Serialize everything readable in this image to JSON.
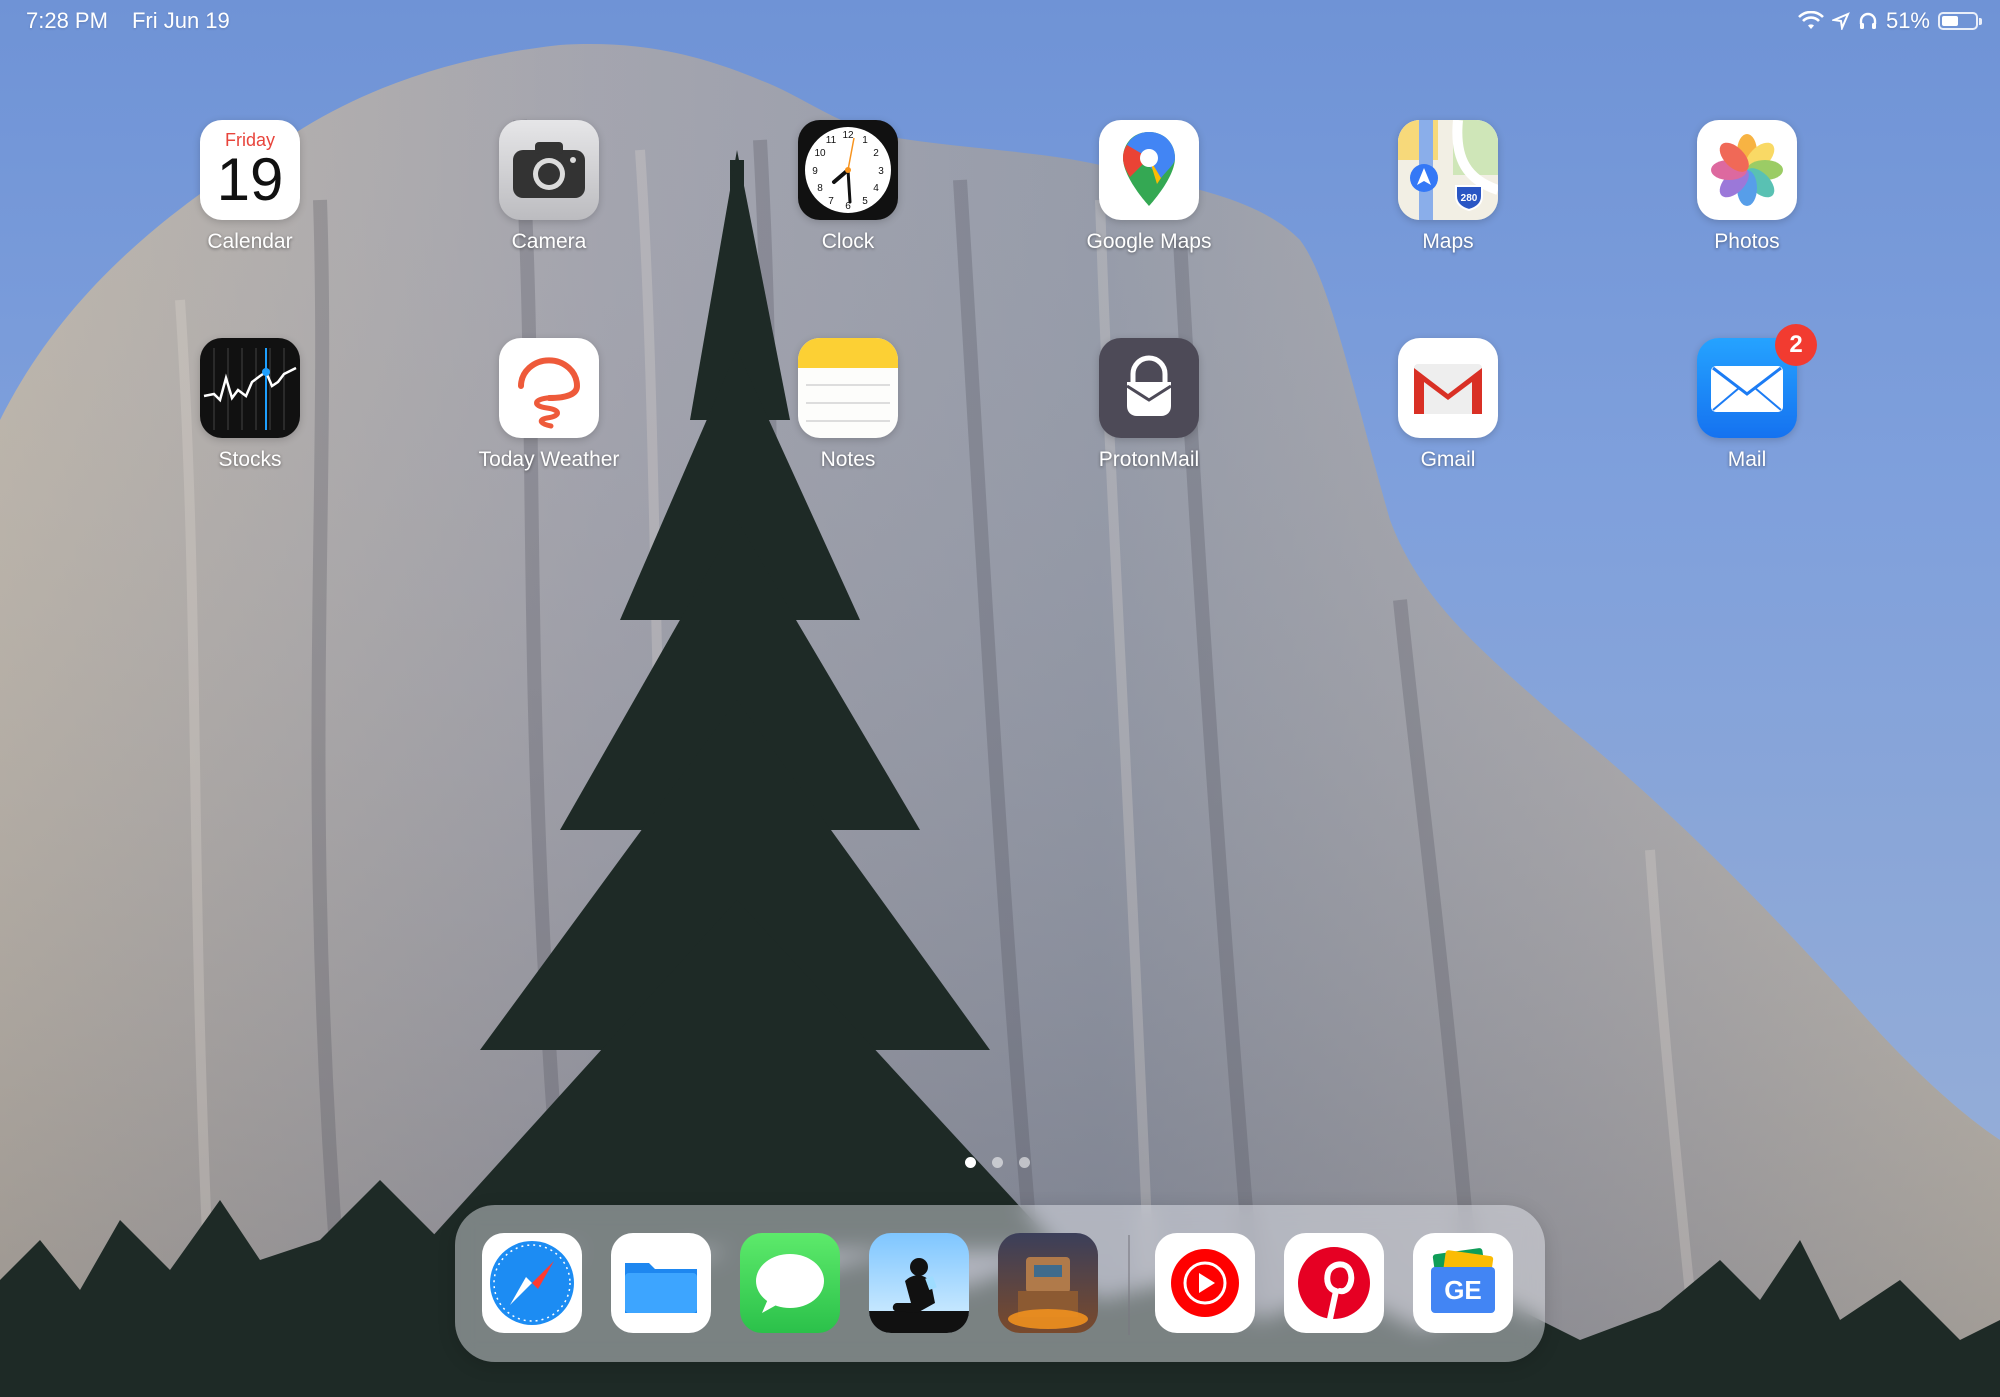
{
  "status_bar": {
    "time": "7:28 PM",
    "date": "Fri Jun 19",
    "battery_percent": "51%",
    "battery_level": 0.51,
    "icons": [
      "wifi-icon",
      "location-icon",
      "headphones-icon",
      "battery-icon"
    ]
  },
  "apps": [
    {
      "name": "Calendar",
      "icon": "calendar-icon",
      "day": "Friday",
      "date": "19"
    },
    {
      "name": "Camera",
      "icon": "camera-icon"
    },
    {
      "name": "Clock",
      "icon": "clock-icon",
      "numerals": [
        "12",
        "1",
        "2",
        "3",
        "4",
        "5",
        "6",
        "7",
        "8",
        "9",
        "10",
        "11"
      ]
    },
    {
      "name": "Google Maps",
      "icon": "google-maps-icon"
    },
    {
      "name": "Maps",
      "icon": "maps-icon",
      "route": "280"
    },
    {
      "name": "Photos",
      "icon": "photos-icon"
    },
    {
      "name": "Stocks",
      "icon": "stocks-icon"
    },
    {
      "name": "Today Weather",
      "icon": "today-weather-icon"
    },
    {
      "name": "Notes",
      "icon": "notes-icon"
    },
    {
      "name": "ProtonMail",
      "icon": "protonmail-icon"
    },
    {
      "name": "Gmail",
      "icon": "gmail-icon"
    },
    {
      "name": "Mail",
      "icon": "mail-icon",
      "badge": "2"
    }
  ],
  "page_indicator": {
    "pages": 3,
    "current": 1
  },
  "dock": [
    {
      "app": "Safari",
      "icon": "safari-icon"
    },
    {
      "app": "Files",
      "icon": "files-icon"
    },
    {
      "app": "Messages",
      "icon": "messages-icon"
    },
    {
      "app": "Kindle",
      "icon": "kindle-icon"
    },
    {
      "app": "Game",
      "icon": "game-icon"
    },
    {
      "app": "YouTube Music",
      "icon": "youtube-music-icon"
    },
    {
      "app": "Pinterest",
      "icon": "pinterest-icon"
    },
    {
      "app": "Google News",
      "icon": "google-news-icon",
      "text": "GE"
    }
  ],
  "colors": {
    "badge": "#f23b30",
    "calendar_red": "#e8453c",
    "notes_yellow": "#fcd034"
  }
}
